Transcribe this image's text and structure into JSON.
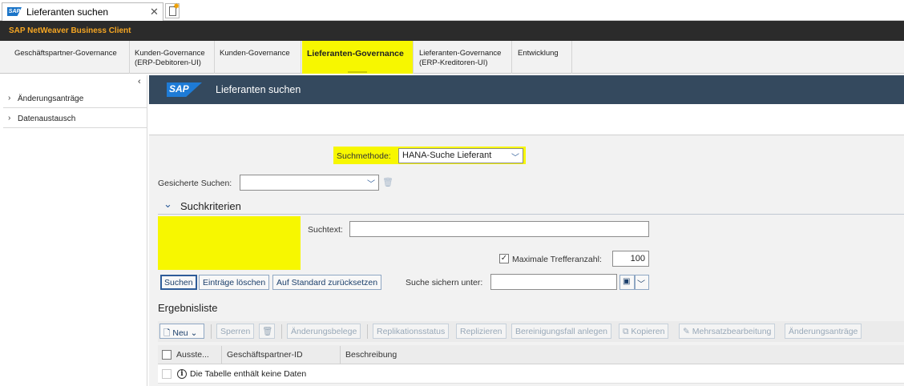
{
  "browser": {
    "tab_title": "Lieferanten suchen",
    "close": "✕"
  },
  "nwbc": {
    "title": "SAP NetWeaver Business Client"
  },
  "nav": {
    "tabs": [
      {
        "label": "Geschäftspartner-Governance"
      },
      {
        "label1": "Kunden-Governance",
        "label2": "(ERP-Debitoren-UI)"
      },
      {
        "label": "Kunden-Governance"
      },
      {
        "label": "Lieferanten-Governance",
        "active": true
      },
      {
        "label1": "Lieferanten-Governance",
        "label2": "(ERP-Kreditoren-UI)"
      },
      {
        "label": "Entwicklung"
      }
    ]
  },
  "sidebar": {
    "collapse": "‹",
    "items": [
      {
        "label": "Änderungsanträge"
      },
      {
        "label": "Datenaustausch"
      }
    ]
  },
  "header": {
    "logo": "SAP",
    "title": "Lieferanten suchen"
  },
  "search": {
    "method_label": "Suchmethode:",
    "method_value": "HANA-Suche Lieferant",
    "saved_label": "Gesicherte Suchen:",
    "saved_value": "",
    "section_title": "Suchkriterien",
    "text_label": "Suchtext:",
    "text_value": "",
    "max_label": "Maximale Trefferanzahl:",
    "max_checked": true,
    "max_value": "100",
    "save_under_label": "Suche sichern unter:",
    "save_under_value": "",
    "buttons": {
      "search": "Suchen",
      "clear": "Einträge löschen",
      "reset": "Auf Standard zurücksetzen"
    }
  },
  "results": {
    "title": "Ergebnisliste",
    "toolbar": {
      "new": "Neu",
      "lock": "Sperren",
      "change_docs": "Änderungsbelege",
      "repl_status": "Replikationsstatus",
      "replicate": "Replizieren",
      "cleanup": "Bereinigungsfall anlegen",
      "copy": "Kopieren",
      "mass": "Mehrsatzbearbeitung",
      "requests": "Änderungsanträge"
    },
    "columns": [
      "Ausste...",
      "Geschäftspartner-ID",
      "Beschreibung"
    ],
    "empty_text": "Die Tabelle enthält keine Daten"
  },
  "colors": {
    "highlight": "#f7f700",
    "header": "#34495e",
    "nwbc_title": "#f5a623",
    "button_border": "#2e5c99"
  }
}
